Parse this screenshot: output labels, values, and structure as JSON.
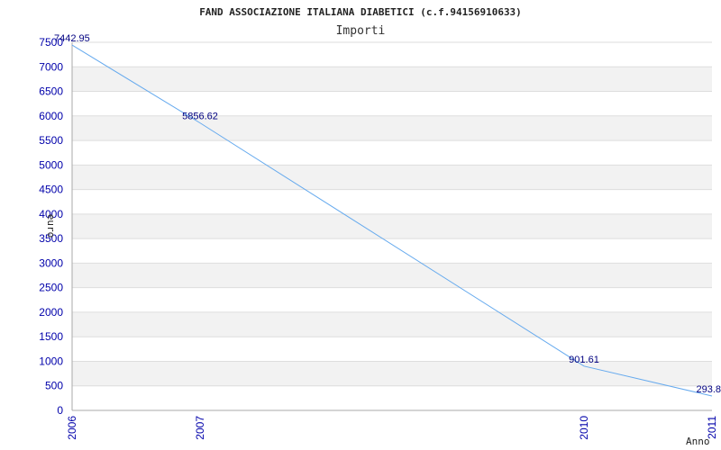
{
  "chart_data": {
    "type": "line",
    "title": "FAND ASSOCIAZIONE ITALIANA DIABETICI (c.f.94156910633)",
    "subtitle": "Importi",
    "xlabel": "Anno",
    "ylabel": "euro",
    "categories": [
      "2006",
      "2007",
      "2010",
      "2011"
    ],
    "series": [
      {
        "values": [
          7442.95,
          5856.62,
          901.61,
          293.8
        ],
        "labels": [
          "7442.95",
          "5856.62",
          "901.61",
          "293.8"
        ]
      }
    ],
    "ylim": [
      0,
      7500
    ],
    "yticks": [
      "0",
      "500",
      "1000",
      "1500",
      "2000",
      "2500",
      "3000",
      "3500",
      "4000",
      "4500",
      "5000",
      "5500",
      "6000",
      "6500",
      "7000",
      "7500"
    ],
    "grid": true,
    "colors": {
      "line": "#66aaee",
      "band": "#f2f2f2",
      "gridline": "#dddddd",
      "axis": "#aaaaaa",
      "tick_text": "#0000aa",
      "data_label": "#000080"
    }
  }
}
